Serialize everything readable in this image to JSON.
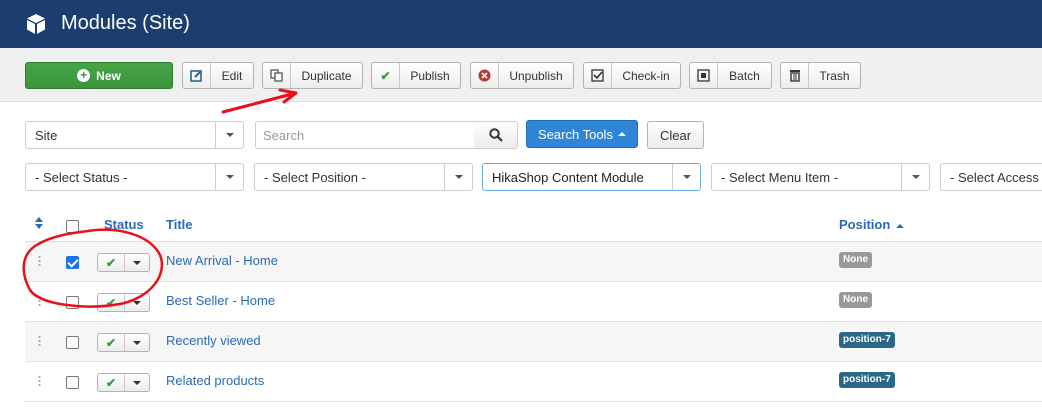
{
  "header": {
    "title": "Modules (Site)",
    "icon": "cube-icon",
    "bg": "#1c3d6e"
  },
  "toolbar": {
    "new_label": "New",
    "edit_label": "Edit",
    "duplicate_label": "Duplicate",
    "publish_label": "Publish",
    "unpublish_label": "Unpublish",
    "checkin_label": "Check-in",
    "batch_label": "Batch",
    "trash_label": "Trash"
  },
  "filters": {
    "client_value": "Site",
    "search_placeholder": "Search",
    "search_tools_label": "Search Tools",
    "clear_label": "Clear",
    "status_value": "- Select Status -",
    "position_value": "- Select Position -",
    "module_value": "HikaShop Content Module",
    "menu_value": "- Select Menu Item -",
    "access_value": "- Select Access -"
  },
  "table": {
    "headers": {
      "status": "Status",
      "title": "Title",
      "position": "Position"
    },
    "rows": [
      {
        "title": "New Arrival - Home",
        "position": "None",
        "checked": true
      },
      {
        "title": "Best Seller - Home",
        "position": "None",
        "checked": false
      },
      {
        "title": "Recently viewed",
        "position": "position-7",
        "checked": false
      },
      {
        "title": "Related products",
        "position": "position-7",
        "checked": false
      }
    ]
  },
  "colors": {
    "accent": "#2f86d6",
    "new_button": "#46a546",
    "annotation": "#e8101a"
  }
}
